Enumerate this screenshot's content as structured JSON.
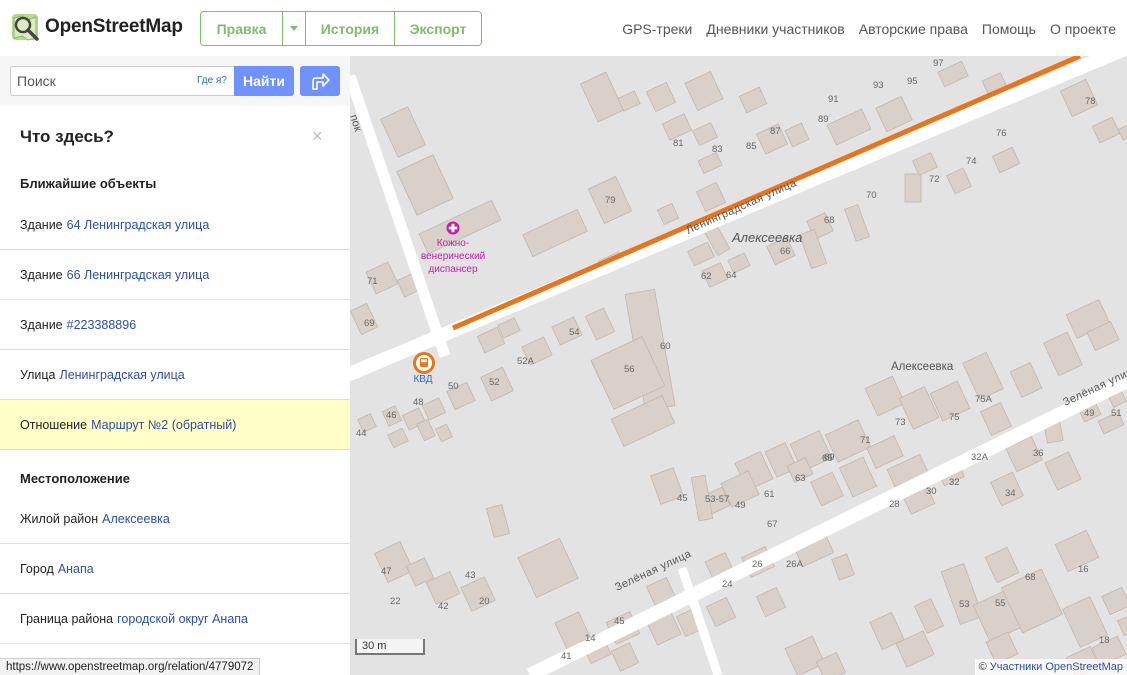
{
  "header": {
    "logo_text": "OpenStreetMap",
    "edit_label": "Правка",
    "history_label": "История",
    "export_label": "Экспорт",
    "nav": [
      "GPS-треки",
      "Дневники участников",
      "Авторские права",
      "Помощь",
      "О проекте"
    ]
  },
  "search": {
    "placeholder": "Поиск",
    "where_am_i": "Где я?",
    "find_label": "Найти"
  },
  "panel": {
    "title": "Что здесь?",
    "close": "×",
    "nearby_heading": "Ближайшие объекты",
    "nearby": [
      {
        "prefix": "Здание",
        "link": "64 Ленинградская улица",
        "highlighted": false
      },
      {
        "prefix": "Здание",
        "link": "66 Ленинградская улица",
        "highlighted": false
      },
      {
        "prefix": "Здание",
        "link": "#223388896",
        "highlighted": false
      },
      {
        "prefix": "Улица",
        "link": "Ленинградская улица",
        "highlighted": false
      },
      {
        "prefix": "Отношение",
        "link": "Маршрут №2 (обратный)",
        "highlighted": true
      }
    ],
    "location_heading": "Местоположение",
    "location": [
      {
        "prefix": "Жилой район",
        "link": "Алексеевка"
      },
      {
        "prefix": "Город",
        "link": "Анапа"
      },
      {
        "prefix": "Граница района",
        "link": "городской округ Анапа"
      }
    ]
  },
  "statusbar": {
    "url": "https://www.openstreetmap.org/relation/4779072"
  },
  "map": {
    "colors": {
      "background": "#e3e3e3",
      "building": "#d9d0c9",
      "building_stroke": "#c4b6ab",
      "road": "#ffffff",
      "route": "#e8751a",
      "poi_medical": "#c71cae",
      "bus_stop": "#e8751a"
    },
    "street_labels": [
      "Ленинградская улица",
      "Зелёная улица",
      "Зелёная улица"
    ],
    "partial_street_label": "пок",
    "place_labels": [
      "Алексеевка",
      "Алексеевка"
    ],
    "poi": {
      "name_lines": [
        "Кожно-",
        "венерический",
        "диспансер"
      ],
      "icon": "cross-icon"
    },
    "bus_stop": {
      "label": "КВД",
      "icon": "bus-icon"
    },
    "house_numbers": [
      "97",
      "95",
      "93",
      "91",
      "89",
      "87",
      "85",
      "83",
      "81",
      "79",
      "78",
      "76",
      "74",
      "72",
      "70",
      "68",
      "66",
      "64",
      "62",
      "60",
      "56",
      "54",
      "52А",
      "52",
      "50",
      "48",
      "46",
      "44",
      "71",
      "69",
      "73",
      "75",
      "75А",
      "71",
      "69",
      "67",
      "65",
      "63",
      "61",
      "53-57",
      "49",
      "45",
      "47",
      "43",
      "42",
      "20",
      "22",
      "24",
      "26",
      "26А",
      "28",
      "30",
      "32",
      "32А",
      "34",
      "36",
      "49",
      "51",
      "53",
      "55",
      "68",
      "16",
      "18",
      "14",
      "45",
      "41"
    ],
    "scale": {
      "label": "30 m"
    },
    "attribution": {
      "prefix": "©",
      "link": "Участники OpenStreetMap"
    }
  }
}
